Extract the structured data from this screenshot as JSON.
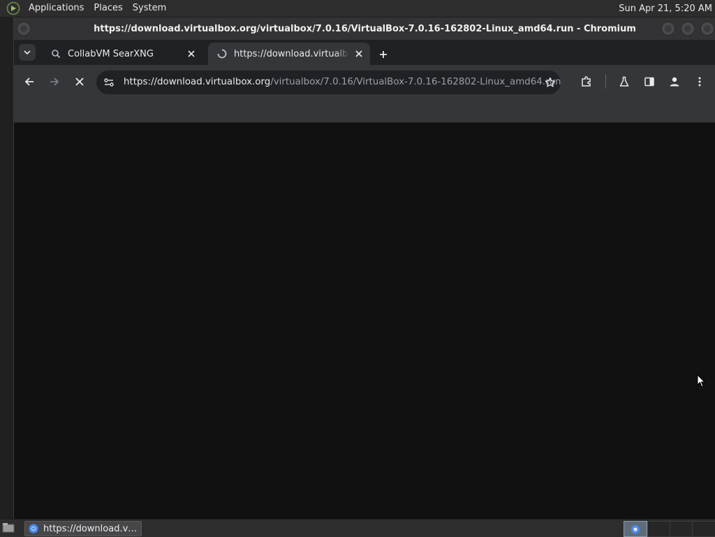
{
  "top_panel": {
    "menus": [
      "Applications",
      "Places",
      "System"
    ],
    "clock": "Sun Apr 21, 5:20 AM"
  },
  "window": {
    "title": "https://download.virtualbox.org/virtualbox/7.0.16/VirtualBox-7.0.16-162802-Linux_amd64.run - Chromium"
  },
  "tabs": [
    {
      "title": "CollabVM SearXNG",
      "active": false
    },
    {
      "title": "https://download.virtualbox.org/virtualbox/7.0.16/VirtualBox-7.0.16-162802-Linux_amd64.run",
      "active": true
    }
  ],
  "omnibox": {
    "url_host": "https://download.virtualbox.org",
    "url_path": "/virtualbox/7.0.16/VirtualBox-7.0.16-162802-Linux_amd64.run"
  },
  "taskbar": {
    "item_label": "https://download.vi...",
    "workspaces": 4,
    "active_workspace": 1
  },
  "colors": {
    "page_background": "#111112",
    "toolbar": "#35363a",
    "tabstrip": "#202124"
  },
  "icons": [
    "distro-logo-icon",
    "tab-search-icon",
    "searxng-favicon-icon",
    "loading-favicon-icon",
    "close-icon",
    "new-tab-icon",
    "back-arrow-icon",
    "forward-arrow-icon",
    "stop-icon",
    "site-settings-icon",
    "star-icon",
    "extensions-icon",
    "labs-flask-icon",
    "side-panel-icon",
    "profile-icon",
    "menu-kebab-icon",
    "show-desktop-icon",
    "chromium-icon"
  ]
}
